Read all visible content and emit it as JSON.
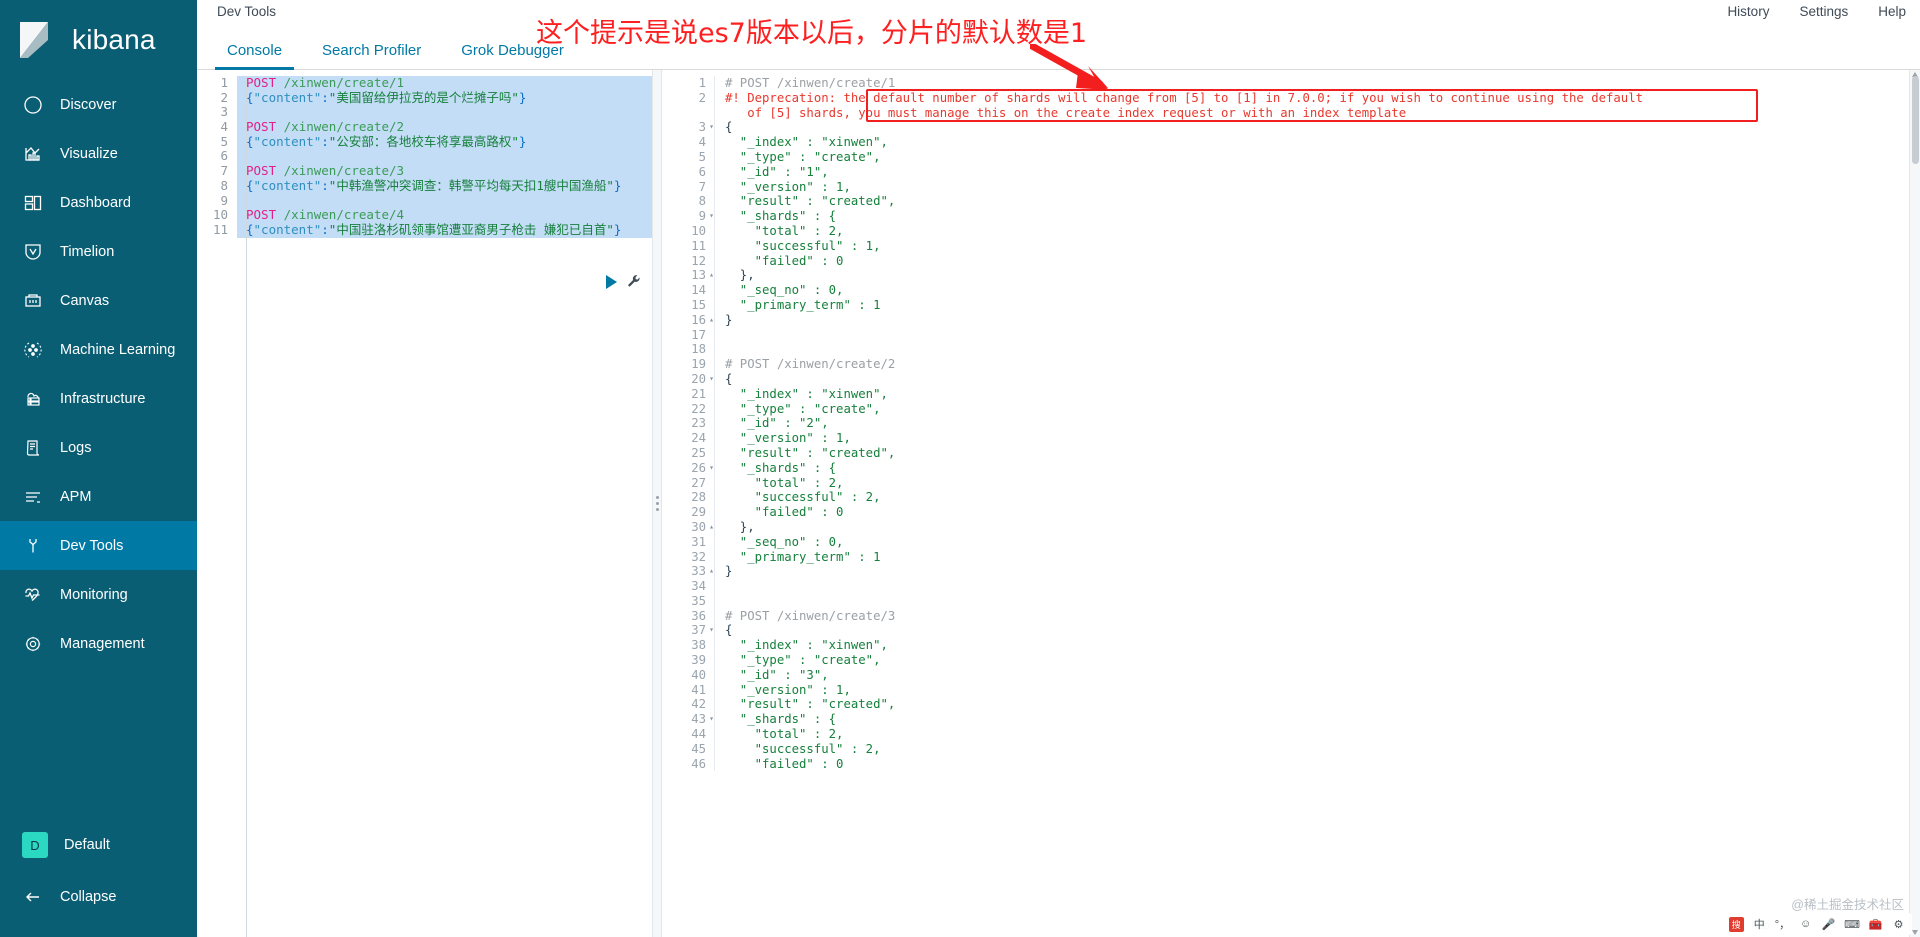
{
  "sidebar": {
    "brand": "kibana",
    "items": [
      {
        "label": "Discover",
        "icon": "compass-icon",
        "active": false
      },
      {
        "label": "Visualize",
        "icon": "bar-chart-icon",
        "active": false
      },
      {
        "label": "Dashboard",
        "icon": "dashboard-icon",
        "active": false
      },
      {
        "label": "Timelion",
        "icon": "timelion-icon",
        "active": false
      },
      {
        "label": "Canvas",
        "icon": "canvas-icon",
        "active": false
      },
      {
        "label": "Machine Learning",
        "icon": "machine-learning-icon",
        "active": false
      },
      {
        "label": "Infrastructure",
        "icon": "infrastructure-icon",
        "active": false
      },
      {
        "label": "Logs",
        "icon": "logs-icon",
        "active": false
      },
      {
        "label": "APM",
        "icon": "apm-icon",
        "active": false
      },
      {
        "label": "Dev Tools",
        "icon": "wrench-icon",
        "active": true
      },
      {
        "label": "Monitoring",
        "icon": "heartbeat-icon",
        "active": false
      },
      {
        "label": "Management",
        "icon": "gear-icon",
        "active": false
      }
    ],
    "space": {
      "initial": "D",
      "label": "Default"
    },
    "collapse": {
      "label": "Collapse",
      "icon": "arrow-left-icon"
    }
  },
  "header": {
    "app_title": "Dev Tools",
    "nav": [
      {
        "label": "History"
      },
      {
        "label": "Settings"
      },
      {
        "label": "Help"
      }
    ]
  },
  "tabs": [
    {
      "label": "Console",
      "active": true
    },
    {
      "label": "Search Profiler",
      "active": false
    },
    {
      "label": "Grok Debugger",
      "active": false
    }
  ],
  "annotation": {
    "text": "这个提示是说es7版本以后，分片的默认数是1",
    "color": "#fe2020",
    "arrow": "red-arrow-icon",
    "highlight_box_color": "#f11f1f"
  },
  "editor": {
    "lines": [
      {
        "n": 1,
        "segments": [
          {
            "t": "POST",
            "c": "method"
          },
          {
            "t": " ",
            "c": "plain"
          },
          {
            "t": "/xinwen/create/1",
            "c": "url"
          }
        ]
      },
      {
        "n": 2,
        "segments": [
          {
            "t": "{",
            "c": "punct"
          },
          {
            "t": "\"content\"",
            "c": "key"
          },
          {
            "t": ":",
            "c": "punct"
          },
          {
            "t": "\"美国留给伊拉克的是个烂摊子吗\"",
            "c": "str"
          },
          {
            "t": "}",
            "c": "punct"
          }
        ]
      },
      {
        "n": 3,
        "segments": []
      },
      {
        "n": 4,
        "segments": [
          {
            "t": "POST",
            "c": "method"
          },
          {
            "t": " ",
            "c": "plain"
          },
          {
            "t": "/xinwen/create/2",
            "c": "url"
          }
        ]
      },
      {
        "n": 5,
        "segments": [
          {
            "t": "{",
            "c": "punct"
          },
          {
            "t": "\"content\"",
            "c": "key"
          },
          {
            "t": ":",
            "c": "punct"
          },
          {
            "t": "\"公安部：各地校车将享最高路权\"",
            "c": "str"
          },
          {
            "t": "}",
            "c": "punct"
          }
        ]
      },
      {
        "n": 6,
        "segments": []
      },
      {
        "n": 7,
        "segments": [
          {
            "t": "POST",
            "c": "method"
          },
          {
            "t": " ",
            "c": "plain"
          },
          {
            "t": "/xinwen/create/3",
            "c": "url"
          }
        ]
      },
      {
        "n": 8,
        "segments": [
          {
            "t": "{",
            "c": "punct"
          },
          {
            "t": "\"content\"",
            "c": "key"
          },
          {
            "t": ":",
            "c": "punct"
          },
          {
            "t": "\"中韩渔警冲突调查：韩警平均每天扣1艘中国渔船\"",
            "c": "str"
          },
          {
            "t": "}",
            "c": "punct"
          }
        ]
      },
      {
        "n": 9,
        "segments": []
      },
      {
        "n": 10,
        "segments": [
          {
            "t": "POST",
            "c": "method"
          },
          {
            "t": " ",
            "c": "plain"
          },
          {
            "t": "/xinwen/create/4",
            "c": "url"
          }
        ]
      },
      {
        "n": 11,
        "segments": [
          {
            "t": "{",
            "c": "punct"
          },
          {
            "t": "\"content\"",
            "c": "key"
          },
          {
            "t": ":",
            "c": "punct"
          },
          {
            "t": "\"中国驻洛杉矶领事馆遭亚裔男子枪击 嫌犯已自首\"",
            "c": "str"
          },
          {
            "t": "}",
            "c": "punct"
          }
        ]
      }
    ],
    "actions": {
      "play": "play-button",
      "wrench": "wrench-button"
    }
  },
  "output": {
    "lines": [
      {
        "n": 1,
        "fold": "",
        "cls": "out-comment",
        "t": "# POST /xinwen/create/1"
      },
      {
        "n": 2,
        "fold": "",
        "cls": "out-dep",
        "t": "#! Deprecation: the default number of shards will change from [5] to [1] in 7.0.0; if you wish to continue using the default"
      },
      {
        "n": "",
        "fold": "",
        "cls": "out-dep",
        "t": "   of [5] shards, you must manage this on the create index request or with an index template"
      },
      {
        "n": 3,
        "fold": "▾",
        "cls": "out-punct",
        "t": "{"
      },
      {
        "n": 4,
        "fold": "",
        "cls": "out-key",
        "t": "  \"_index\" : \"xinwen\","
      },
      {
        "n": 5,
        "fold": "",
        "cls": "out-key",
        "t": "  \"_type\" : \"create\","
      },
      {
        "n": 6,
        "fold": "",
        "cls": "out-key",
        "t": "  \"_id\" : \"1\","
      },
      {
        "n": 7,
        "fold": "",
        "cls": "out-key",
        "t": "  \"_version\" : 1,"
      },
      {
        "n": 8,
        "fold": "",
        "cls": "out-key",
        "t": "  \"result\" : \"created\","
      },
      {
        "n": 9,
        "fold": "▾",
        "cls": "out-key",
        "t": "  \"_shards\" : {"
      },
      {
        "n": 10,
        "fold": "",
        "cls": "out-key",
        "t": "    \"total\" : 2,"
      },
      {
        "n": 11,
        "fold": "",
        "cls": "out-key",
        "t": "    \"successful\" : 1,"
      },
      {
        "n": 12,
        "fold": "",
        "cls": "out-key",
        "t": "    \"failed\" : 0"
      },
      {
        "n": 13,
        "fold": "▴",
        "cls": "out-punct",
        "t": "  },"
      },
      {
        "n": 14,
        "fold": "",
        "cls": "out-key",
        "t": "  \"_seq_no\" : 0,"
      },
      {
        "n": 15,
        "fold": "",
        "cls": "out-key",
        "t": "  \"_primary_term\" : 1"
      },
      {
        "n": 16,
        "fold": "▴",
        "cls": "out-punct",
        "t": "}"
      },
      {
        "n": 17,
        "fold": "",
        "cls": "out-punct",
        "t": ""
      },
      {
        "n": 18,
        "fold": "",
        "cls": "out-punct",
        "t": ""
      },
      {
        "n": 19,
        "fold": "",
        "cls": "out-comment",
        "t": "# POST /xinwen/create/2"
      },
      {
        "n": 20,
        "fold": "▾",
        "cls": "out-punct",
        "t": "{"
      },
      {
        "n": 21,
        "fold": "",
        "cls": "out-key",
        "t": "  \"_index\" : \"xinwen\","
      },
      {
        "n": 22,
        "fold": "",
        "cls": "out-key",
        "t": "  \"_type\" : \"create\","
      },
      {
        "n": 23,
        "fold": "",
        "cls": "out-key",
        "t": "  \"_id\" : \"2\","
      },
      {
        "n": 24,
        "fold": "",
        "cls": "out-key",
        "t": "  \"_version\" : 1,"
      },
      {
        "n": 25,
        "fold": "",
        "cls": "out-key",
        "t": "  \"result\" : \"created\","
      },
      {
        "n": 26,
        "fold": "▾",
        "cls": "out-key",
        "t": "  \"_shards\" : {"
      },
      {
        "n": 27,
        "fold": "",
        "cls": "out-key",
        "t": "    \"total\" : 2,"
      },
      {
        "n": 28,
        "fold": "",
        "cls": "out-key",
        "t": "    \"successful\" : 2,"
      },
      {
        "n": 29,
        "fold": "",
        "cls": "out-key",
        "t": "    \"failed\" : 0"
      },
      {
        "n": 30,
        "fold": "▴",
        "cls": "out-punct",
        "t": "  },"
      },
      {
        "n": 31,
        "fold": "",
        "cls": "out-key",
        "t": "  \"_seq_no\" : 0,"
      },
      {
        "n": 32,
        "fold": "",
        "cls": "out-key",
        "t": "  \"_primary_term\" : 1"
      },
      {
        "n": 33,
        "fold": "▴",
        "cls": "out-punct",
        "t": "}"
      },
      {
        "n": 34,
        "fold": "",
        "cls": "out-punct",
        "t": ""
      },
      {
        "n": 35,
        "fold": "",
        "cls": "out-punct",
        "t": ""
      },
      {
        "n": 36,
        "fold": "",
        "cls": "out-comment",
        "t": "# POST /xinwen/create/3"
      },
      {
        "n": 37,
        "fold": "▾",
        "cls": "out-punct",
        "t": "{"
      },
      {
        "n": 38,
        "fold": "",
        "cls": "out-key",
        "t": "  \"_index\" : \"xinwen\","
      },
      {
        "n": 39,
        "fold": "",
        "cls": "out-key",
        "t": "  \"_type\" : \"create\","
      },
      {
        "n": 40,
        "fold": "",
        "cls": "out-key",
        "t": "  \"_id\" : \"3\","
      },
      {
        "n": 41,
        "fold": "",
        "cls": "out-key",
        "t": "  \"_version\" : 1,"
      },
      {
        "n": 42,
        "fold": "",
        "cls": "out-key",
        "t": "  \"result\" : \"created\","
      },
      {
        "n": 43,
        "fold": "▾",
        "cls": "out-key",
        "t": "  \"_shards\" : {"
      },
      {
        "n": 44,
        "fold": "",
        "cls": "out-key",
        "t": "    \"total\" : 2,"
      },
      {
        "n": 45,
        "fold": "",
        "cls": "out-key",
        "t": "    \"successful\" : 2,"
      },
      {
        "n": 46,
        "fold": "",
        "cls": "out-key",
        "t": "    \"failed\" : 0"
      }
    ]
  },
  "watermark": {
    "text": "@稀土掘金技术社区",
    "url_ghost": "http"
  },
  "ime": {
    "lang": "中",
    "punct": "°，",
    "items": [
      "smiley-icon",
      "mic-icon",
      "keyboard-icon",
      "toolbox-icon",
      "settings-icon"
    ]
  }
}
